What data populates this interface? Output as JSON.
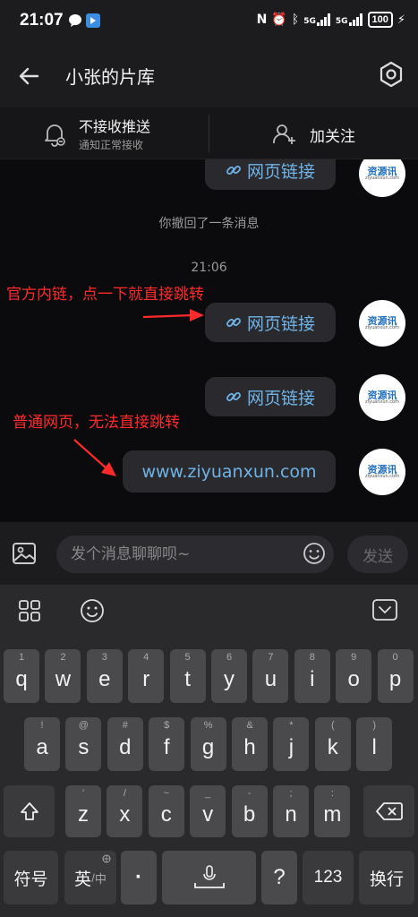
{
  "status_bar": {
    "time": "21:07",
    "battery": "100",
    "network": "5G"
  },
  "header": {
    "title": "小张的片库"
  },
  "sub_bar": {
    "push_title": "不接收推送",
    "push_subtitle": "通知正常接收",
    "follow_label": "加关注"
  },
  "chat": {
    "messages": [
      {
        "type": "link",
        "text": "网页链接",
        "icon": "link-icon"
      },
      {
        "type": "system",
        "text": "你撤回了一条消息"
      },
      {
        "type": "time",
        "text": "21:06"
      },
      {
        "type": "link",
        "text": "网页链接",
        "icon": "link-icon"
      },
      {
        "type": "link",
        "text": "网页链接",
        "icon": "link-icon"
      },
      {
        "type": "text",
        "text": "www.ziyuanxun.com"
      }
    ],
    "annotations": [
      "官方内链，点一下就直接跳转",
      "普通网页，无法直接跳转"
    ],
    "avatar_text": "资源讯",
    "avatar_sub": "ziyuanxun.com"
  },
  "input_bar": {
    "placeholder": "发个消息聊聊呗~",
    "send_label": "发送"
  },
  "keyboard": {
    "row1": [
      {
        "k": "q",
        "h": "1"
      },
      {
        "k": "w",
        "h": "2"
      },
      {
        "k": "e",
        "h": "3"
      },
      {
        "k": "r",
        "h": "4"
      },
      {
        "k": "t",
        "h": "5"
      },
      {
        "k": "y",
        "h": "6"
      },
      {
        "k": "u",
        "h": "7"
      },
      {
        "k": "i",
        "h": "8"
      },
      {
        "k": "o",
        "h": "9"
      },
      {
        "k": "p",
        "h": "0"
      }
    ],
    "row2": [
      {
        "k": "a",
        "h": "!"
      },
      {
        "k": "s",
        "h": "@"
      },
      {
        "k": "d",
        "h": "#"
      },
      {
        "k": "f",
        "h": "$"
      },
      {
        "k": "g",
        "h": "%"
      },
      {
        "k": "h",
        "h": "&"
      },
      {
        "k": "j",
        "h": "*"
      },
      {
        "k": "k",
        "h": "("
      },
      {
        "k": "l",
        "h": ")"
      }
    ],
    "row3": [
      {
        "k": "z",
        "h": "'"
      },
      {
        "k": "x",
        "h": "/"
      },
      {
        "k": "c",
        "h": "~"
      },
      {
        "k": "v",
        "h": "_"
      },
      {
        "k": "b",
        "h": "-"
      },
      {
        "k": "n",
        "h": ";"
      },
      {
        "k": "m",
        "h": ":"
      }
    ],
    "symbols_label": "符号",
    "lang_label": "英",
    "lang_sub": "中",
    "comma_label": "·",
    "question_label": "?",
    "numbers_label": "123",
    "enter_label": "换行"
  },
  "colors": {
    "link_blue": "#6fb3e6",
    "annotation_red": "#ff2a2a",
    "bubble_bg": "#2a2a2e"
  }
}
